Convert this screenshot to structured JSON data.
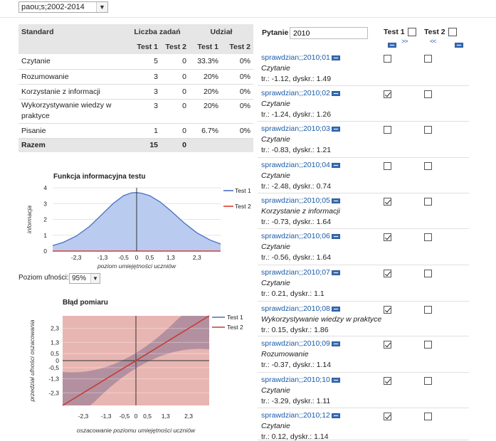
{
  "selector": {
    "value": "paou;s;2002-2014"
  },
  "standards_table": {
    "headers": {
      "standard": "Standard",
      "count": "Liczba zadań",
      "share": "Udział",
      "test1": "Test 1",
      "test2": "Test 2"
    },
    "rows": [
      {
        "name": "Czytanie",
        "c1": "5",
        "c2": "0",
        "s1": "33.3%",
        "s2": "0%"
      },
      {
        "name": "Rozumowanie",
        "c1": "3",
        "c2": "0",
        "s1": "20%",
        "s2": "0%"
      },
      {
        "name": "Korzystanie z informacji",
        "c1": "3",
        "c2": "0",
        "s1": "20%",
        "s2": "0%"
      },
      {
        "name_line1": "Wykorzystywanie wiedzy w",
        "name_line2": "praktyce",
        "c1": "3",
        "c2": "0",
        "s1": "20%",
        "s2": "0%"
      },
      {
        "name": "Pisanie",
        "c1": "1",
        "c2": "0",
        "s1": "6.7%",
        "s2": "0%"
      }
    ],
    "total": {
      "name": "Razem",
      "c1": "15",
      "c2": "0"
    }
  },
  "info_chart_title": "Funkcja informacyjna testu",
  "confidence": {
    "label": "Poziom ufności:",
    "value": "95%"
  },
  "error_chart_title": "Błąd pomiaru",
  "chart_data": [
    {
      "type": "area",
      "title": "Funkcja informacyjna testu",
      "xlabel": "poziom umiejętności uczniów",
      "ylabel": "informacja",
      "x_ticks": [
        "-2,3",
        "-1,3",
        "-0,5",
        "0",
        "0,5",
        "1,3",
        "2,3"
      ],
      "y_ticks": [
        "0",
        "1",
        "2",
        "3",
        "4"
      ],
      "xlim": [
        -3.2,
        3.2
      ],
      "ylim": [
        0,
        4
      ],
      "series": [
        {
          "name": "Test 1",
          "color": "#4a6fc2",
          "fill": "#b9cbef",
          "x": [
            -3.2,
            -2.8,
            -2.3,
            -1.8,
            -1.3,
            -0.9,
            -0.5,
            -0.2,
            0,
            0.2,
            0.5,
            0.9,
            1.3,
            1.8,
            2.3,
            2.8,
            3.2
          ],
          "y": [
            0.35,
            0.55,
            0.95,
            1.55,
            2.35,
            3.0,
            3.5,
            3.68,
            3.7,
            3.65,
            3.5,
            3.1,
            2.55,
            1.8,
            1.15,
            0.7,
            0.45
          ]
        },
        {
          "name": "Test 2",
          "color": "#e03b2f",
          "x": [
            -3.2,
            3.2
          ],
          "y": [
            0,
            0
          ]
        }
      ]
    },
    {
      "type": "line",
      "title": "Błąd pomiaru",
      "xlabel": "oszacowanie poziomu umiejętności uczniów",
      "ylabel": "przedział ufności oszacowania",
      "x_ticks": [
        "-2,3",
        "-1,3",
        "-0,5",
        "0",
        "0,5",
        "1,3",
        "2,3"
      ],
      "y_ticks": [
        "2,3",
        "1,3",
        "0,5",
        "0",
        "-0,5",
        "-1,3",
        "-2,3"
      ],
      "xlim": [
        -3.2,
        3.2
      ],
      "ylim": [
        -3.2,
        3.2
      ],
      "series": [
        {
          "name": "Test 1",
          "color": "#4a6fc2"
        },
        {
          "name": "Test 2",
          "color": "#c83a32",
          "x": [
            -3.2,
            3.2
          ],
          "y": [
            -3.2,
            3.2
          ]
        }
      ]
    }
  ],
  "questions_panel": {
    "label": "Pytanie",
    "search_value": "2010",
    "col1": "Test 1",
    "col2": "Test 2",
    "nav_right": ">>",
    "nav_left": "<<",
    "items": [
      {
        "id": "sprawdzian;;2010;01",
        "category": "Czytanie",
        "stats": "tr.: -1.12, dyskr.: 1.49",
        "t1": false,
        "t2": false
      },
      {
        "id": "sprawdzian;;2010;02",
        "category": "Czytanie",
        "stats": "tr.: -1.24, dyskr.: 1.26",
        "t1": true,
        "t2": false
      },
      {
        "id": "sprawdzian;;2010;03",
        "category": "Czytanie",
        "stats": "tr.: -0.83, dyskr.: 1.21",
        "t1": false,
        "t2": false
      },
      {
        "id": "sprawdzian;;2010;04",
        "category": "Czytanie",
        "stats": "tr.: -2.48, dyskr.: 0.74",
        "t1": false,
        "t2": false
      },
      {
        "id": "sprawdzian;;2010;05",
        "category": "Korzystanie z informacji",
        "stats": "tr.: -0.73, dyskr.: 1.64",
        "t1": true,
        "t2": false
      },
      {
        "id": "sprawdzian;;2010;06",
        "category": "Czytanie",
        "stats": "tr.: -0.56, dyskr.: 1.64",
        "t1": true,
        "t2": false
      },
      {
        "id": "sprawdzian;;2010;07",
        "category": "Czytanie",
        "stats": "tr.: 0.21, dyskr.: 1.1",
        "t1": true,
        "t2": false
      },
      {
        "id": "sprawdzian;;2010;08",
        "category": "Wykorzystywanie wiedzy w praktyce",
        "stats": "tr.: 0.15, dyskr.: 1.86",
        "t1": true,
        "t2": false
      },
      {
        "id": "sprawdzian;;2010;09",
        "category": "Rozumowanie",
        "stats": "tr.: -0.37, dyskr.: 1.14",
        "t1": true,
        "t2": false
      },
      {
        "id": "sprawdzian;;2010;10",
        "category": "Czytanie",
        "stats": "tr.: -3.29, dyskr.: 1.11",
        "t1": true,
        "t2": false
      },
      {
        "id": "sprawdzian;;2010;12",
        "category": "Czytanie",
        "stats": "tr.: 0.12, dyskr.: 1.14",
        "t1": true,
        "t2": false
      }
    ]
  }
}
